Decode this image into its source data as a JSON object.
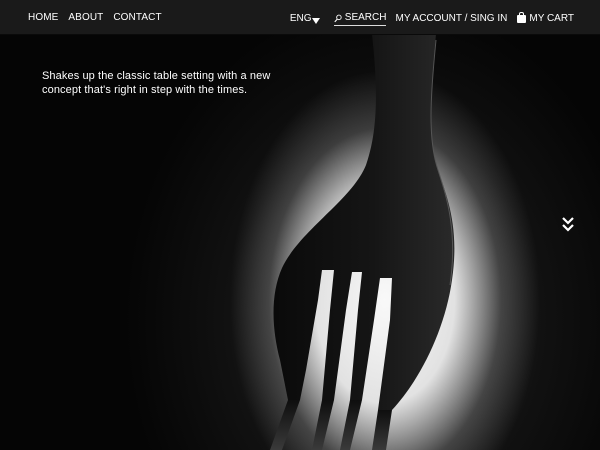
{
  "nav": {
    "home": "HOME",
    "about": "ABOUT",
    "contact": "CONTACT"
  },
  "header_right": {
    "language": "ENG",
    "search_label": "SEARCH",
    "account_label": "MY ACCOUNT / SING IN",
    "cart_label": "MY CART"
  },
  "hero": {
    "tagline": "Shakes up the classic table setting with a new concept that's right in step with the times."
  },
  "colors": {
    "topbar_bg": "#1a1a1a",
    "text": "#ffffff",
    "background": "#000000"
  },
  "icons": {
    "language_caret": "caret-down-icon",
    "search": "magnifier-icon",
    "cart": "bag-icon",
    "scroll": "double-chevron-down-icon"
  }
}
